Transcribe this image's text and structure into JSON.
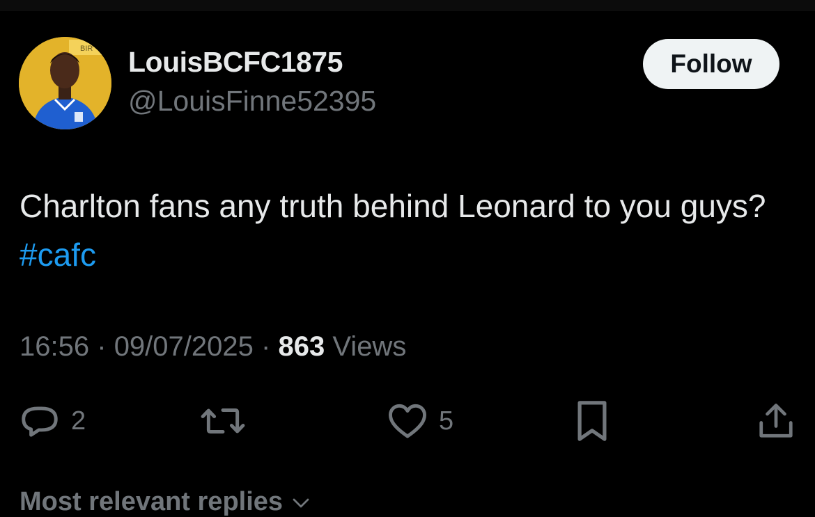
{
  "colors": {
    "background": "#000000",
    "text_primary": "#e7e9ea",
    "text_secondary": "#71767b",
    "link": "#1d9bf0",
    "follow_bg": "#eff3f4"
  },
  "author": {
    "display_name": "LouisBCFC1875",
    "handle": "@LouisFinne52395",
    "avatar_icon": "profile-photo-blue-kit"
  },
  "follow_button": {
    "label": "Follow"
  },
  "tweet": {
    "text": "Charlton fans any truth behind Leonard to you guys?",
    "hashtag": "#cafc"
  },
  "meta": {
    "time": "16:56",
    "separator": "·",
    "date": "09/07/2025",
    "views_count": "863",
    "views_label": "Views"
  },
  "actions": {
    "reply": {
      "icon": "reply-icon",
      "count": "2"
    },
    "retweet": {
      "icon": "retweet-icon"
    },
    "like": {
      "icon": "heart-icon",
      "count": "5"
    },
    "bookmark": {
      "icon": "bookmark-icon"
    },
    "share": {
      "icon": "share-icon"
    }
  },
  "replies_header": {
    "label": "Most relevant replies",
    "icon": "chevron-down-icon"
  }
}
